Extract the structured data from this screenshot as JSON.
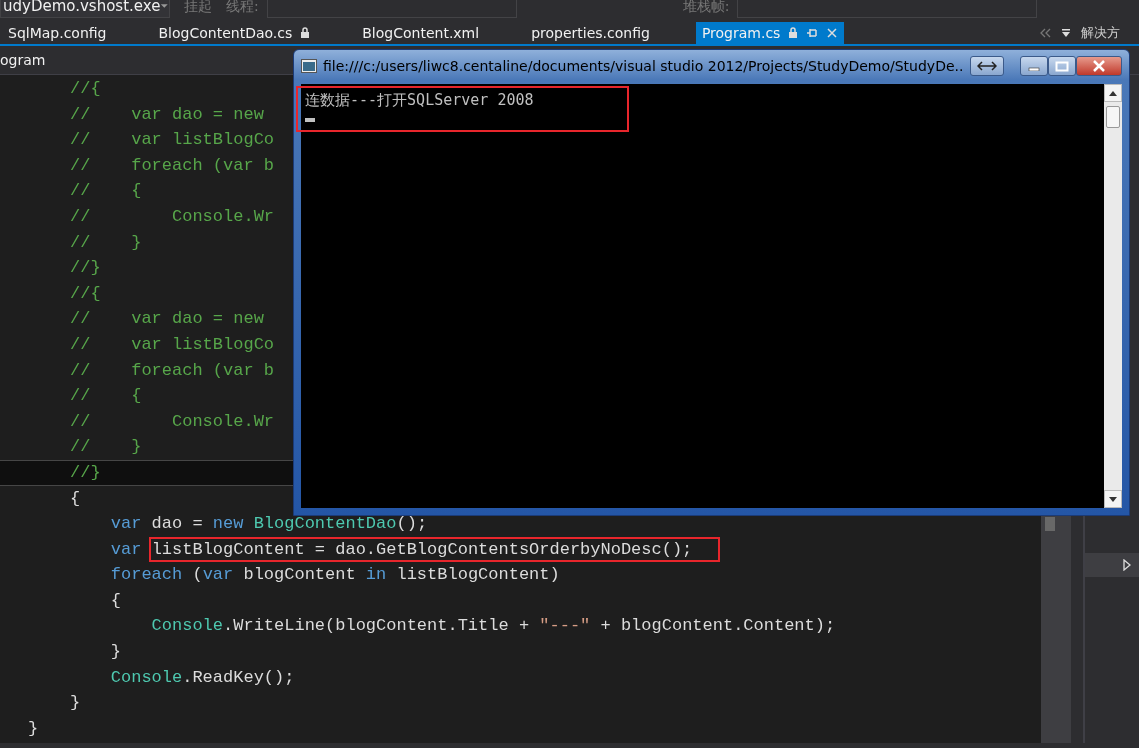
{
  "toolbar": {
    "process": "udyDemo.vshost.exe",
    "suspend": "挂起",
    "thread_label": "线程:",
    "stack_label": "堆栈帧:"
  },
  "tabs": [
    {
      "label": "SqlMap.config",
      "selected": false,
      "locked": false
    },
    {
      "label": "BlogContentDao.cs",
      "selected": false,
      "locked": true
    },
    {
      "label": "BlogContent.xml",
      "selected": false,
      "locked": false
    },
    {
      "label": "properties.config",
      "selected": false,
      "locked": false
    },
    {
      "label": "Program.cs",
      "selected": true,
      "locked": true
    }
  ],
  "side_panel": {
    "title": "解决方"
  },
  "nav_bar": {
    "type_name": "ogram"
  },
  "code_lines": [
    {
      "current": false,
      "tokens": [
        {
          "kind": "comment",
          "text": "//{"
        }
      ]
    },
    {
      "current": false,
      "tokens": [
        {
          "kind": "comment",
          "text": "//    var dao = new"
        }
      ]
    },
    {
      "current": false,
      "tokens": [
        {
          "kind": "comment",
          "text": "//    var listBlogCo"
        }
      ]
    },
    {
      "current": false,
      "tokens": [
        {
          "kind": "comment",
          "text": "//    foreach (var b"
        }
      ]
    },
    {
      "current": false,
      "tokens": [
        {
          "kind": "comment",
          "text": "//    {"
        }
      ]
    },
    {
      "current": false,
      "tokens": [
        {
          "kind": "comment",
          "text": "//        Console.Wr"
        }
      ]
    },
    {
      "current": false,
      "tokens": [
        {
          "kind": "comment",
          "text": "//    }"
        }
      ]
    },
    {
      "current": false,
      "tokens": [
        {
          "kind": "comment",
          "text": "//}"
        }
      ]
    },
    {
      "current": false,
      "tokens": [
        {
          "kind": "comment",
          "text": "//{"
        }
      ]
    },
    {
      "current": false,
      "tokens": [
        {
          "kind": "comment",
          "text": "//    var dao = new"
        }
      ]
    },
    {
      "current": false,
      "tokens": [
        {
          "kind": "comment",
          "text": "//    var listBlogCo"
        }
      ]
    },
    {
      "current": false,
      "tokens": [
        {
          "kind": "comment",
          "text": "//    foreach (var b"
        }
      ]
    },
    {
      "current": false,
      "tokens": [
        {
          "kind": "comment",
          "text": "//    {"
        }
      ]
    },
    {
      "current": false,
      "tokens": [
        {
          "kind": "comment",
          "text": "//        Console.Wr"
        }
      ]
    },
    {
      "current": false,
      "tokens": [
        {
          "kind": "comment",
          "text": "//    }"
        }
      ]
    },
    {
      "current": true,
      "tokens": [
        {
          "kind": "comment",
          "text": "//}"
        }
      ]
    },
    {
      "current": false,
      "tokens": [
        {
          "kind": "plain",
          "text": "{"
        }
      ]
    },
    {
      "current": false,
      "tokens": [
        {
          "kind": "keyword",
          "text": "    var"
        },
        {
          "kind": "plain",
          "text": " dao = "
        },
        {
          "kind": "keyword",
          "text": "new"
        },
        {
          "kind": "type",
          "text": " BlogContentDao"
        },
        {
          "kind": "plain",
          "text": "();"
        }
      ]
    },
    {
      "current": false,
      "tokens": [
        {
          "kind": "keyword",
          "text": "    var "
        },
        {
          "kind": "plain",
          "text": "listBlogContent = dao.GetBlogContentsOrderbyNoDesc();",
          "boxed": true
        }
      ]
    },
    {
      "current": false,
      "tokens": [
        {
          "kind": "keyword",
          "text": "    foreach"
        },
        {
          "kind": "plain",
          "text": " ("
        },
        {
          "kind": "keyword",
          "text": "var"
        },
        {
          "kind": "plain",
          "text": " blogContent "
        },
        {
          "kind": "keyword",
          "text": "in"
        },
        {
          "kind": "plain",
          "text": " listBlogContent)"
        }
      ]
    },
    {
      "current": false,
      "tokens": [
        {
          "kind": "plain",
          "text": "    {"
        }
      ]
    },
    {
      "current": false,
      "tokens": [
        {
          "kind": "type",
          "text": "        Console"
        },
        {
          "kind": "plain",
          "text": ".WriteLine(blogContent.Title + "
        },
        {
          "kind": "string",
          "text": "\"---\""
        },
        {
          "kind": "plain",
          "text": " + blogContent.Content);"
        }
      ]
    },
    {
      "current": false,
      "tokens": [
        {
          "kind": "plain",
          "text": "    }"
        }
      ]
    },
    {
      "current": false,
      "tokens": [
        {
          "kind": "type",
          "text": "    Console"
        },
        {
          "kind": "plain",
          "text": ".ReadKey();"
        }
      ]
    },
    {
      "current": false,
      "tokens": [
        {
          "kind": "plain",
          "text": "}"
        }
      ]
    },
    {
      "current": false,
      "tokens": [
        {
          "kind": "plain",
          "text": "}"
        }
      ]
    }
  ],
  "console": {
    "title": "file:///c:/users/liwc8.centaline/documents/visual studio 2012/Projects/StudyDemo/StudyDe..",
    "lines": [
      "连数据---打开SQLServer 2008"
    ]
  }
}
